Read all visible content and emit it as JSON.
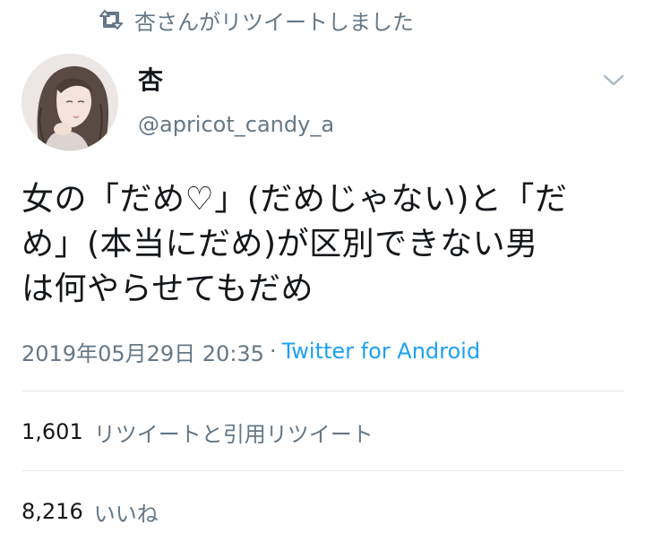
{
  "retweet_context": {
    "icon": "retweet-icon",
    "text": "杏さんがリツイートしました"
  },
  "author": {
    "display_name": "杏",
    "username": "@apricot_candy_a",
    "avatar": "illustrated-girl-avatar"
  },
  "menu": {
    "icon": "chevron-down-icon"
  },
  "tweet": {
    "text_lines": [
      "女の「だめ♡」(だめじゃない)と「だ",
      "め」(本当にだめ)が区別できない男",
      "は何やらせてもだめ"
    ],
    "timestamp": "2019年05月29日 20:35",
    "separator": "·",
    "source": "Twitter for Android"
  },
  "stats": {
    "retweets_count": "1,601",
    "retweets_label": "リツイートと引用リツイート",
    "likes_count": "8,216",
    "likes_label": "いいね"
  },
  "colors": {
    "text": "#14171a",
    "secondary": "#657786",
    "link": "#1da1f2",
    "divider": "#e1e8ed"
  }
}
